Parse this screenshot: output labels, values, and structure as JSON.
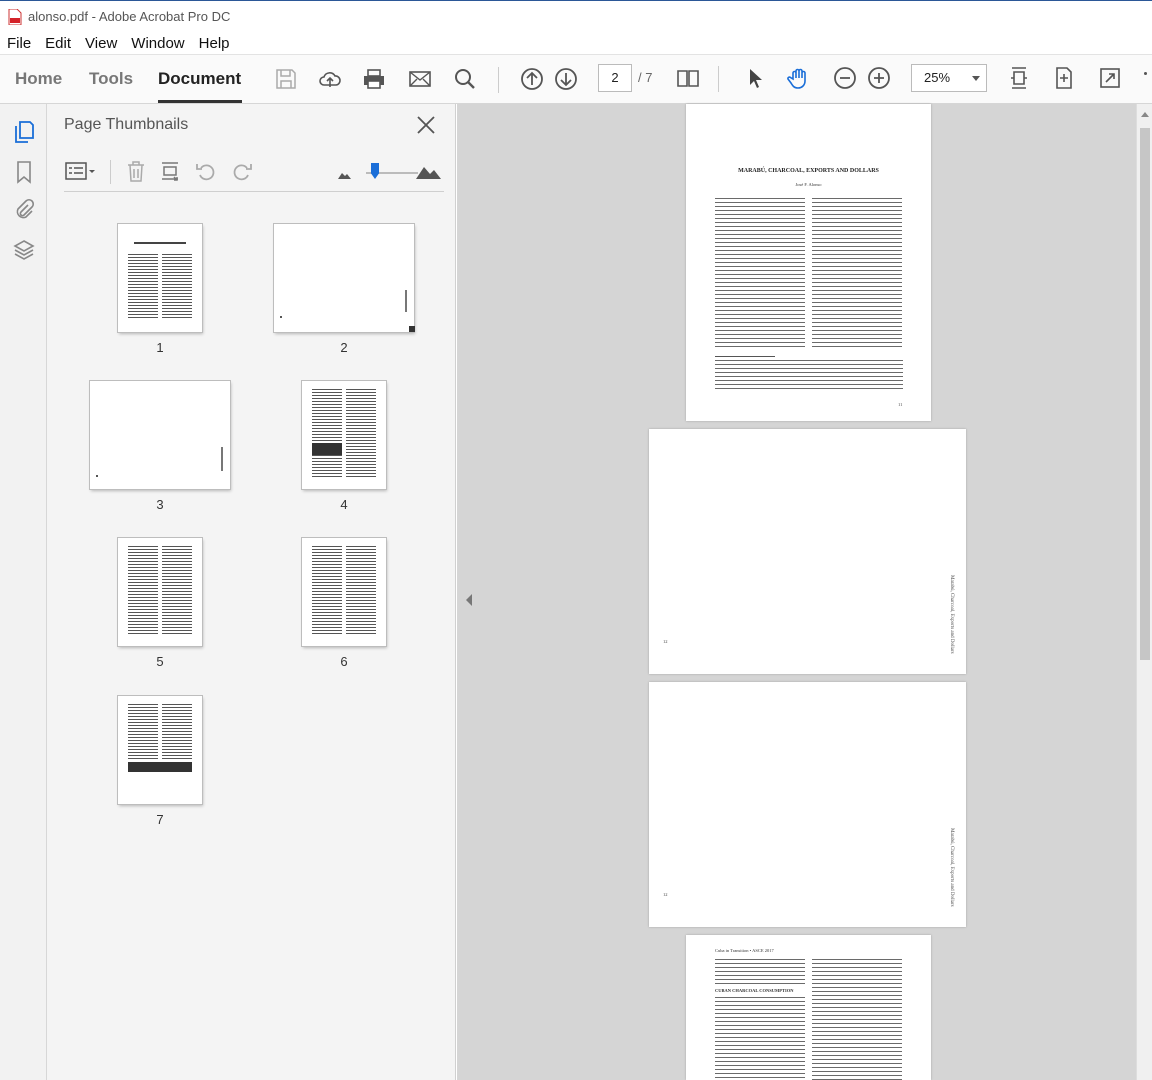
{
  "window": {
    "title": "alonso.pdf - Adobe Acrobat Pro DC"
  },
  "menu": [
    "File",
    "Edit",
    "View",
    "Window",
    "Help"
  ],
  "tabs": {
    "home": "Home",
    "tools": "Tools",
    "document": "Document"
  },
  "navigation": {
    "current_page": "2",
    "total_pages": "/ 7"
  },
  "zoom": {
    "value": "25%"
  },
  "thumbnails_panel": {
    "title": "Page Thumbnails",
    "pages": [
      "1",
      "2",
      "3",
      "4",
      "5",
      "6",
      "7"
    ],
    "selected_page": "2"
  },
  "document": {
    "page1": {
      "title": "MARABÚ, CHARCOAL, EXPORTS AND DOLLARS",
      "author": "José F. Alonso",
      "page_number": "11"
    },
    "page2": {
      "running_head": "Marabú, Charcoal, Exports and Dollars",
      "page_number": "12"
    },
    "page3": {
      "running_head": "Marabú, Charcoal, Exports and Dollars",
      "page_number": "12"
    },
    "page4": {
      "header": "Cuba in Transition • ASCE 2017",
      "section_heading": "CUBAN CHARCOAL CONSUMPTION"
    }
  },
  "colors": {
    "accent": "#1a6ed8",
    "pdf_red": "#d4232a",
    "title_accent": "#2b5797"
  }
}
